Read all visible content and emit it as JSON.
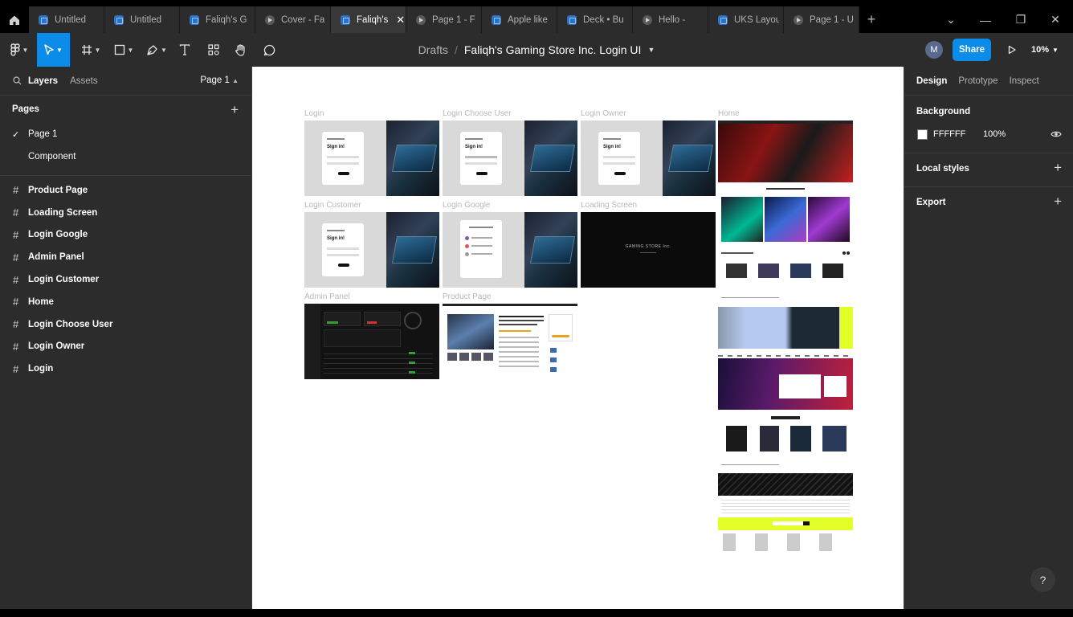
{
  "tabs": [
    {
      "label": "Untitled",
      "type": "file",
      "active": false
    },
    {
      "label": "Untitled",
      "type": "file",
      "active": false
    },
    {
      "label": "Faliqh's G",
      "type": "file",
      "active": false
    },
    {
      "label": "Cover - Fa",
      "type": "proto",
      "active": false
    },
    {
      "label": "Faliqh's",
      "type": "file",
      "active": true
    },
    {
      "label": "Page 1 - F",
      "type": "proto",
      "active": false
    },
    {
      "label": "Apple like",
      "type": "file",
      "active": false
    },
    {
      "label": "Deck • Bu",
      "type": "file",
      "active": false
    },
    {
      "label": "Hello -",
      "type": "proto",
      "active": false
    },
    {
      "label": "UKS Layou",
      "type": "file",
      "active": false
    },
    {
      "label": "Page 1 - U",
      "type": "proto",
      "active": false
    }
  ],
  "toolbar": {
    "breadcrumb_drafts": "Drafts",
    "breadcrumb_sep": "/",
    "file_name": "Faliqh's Gaming Store Inc. Login UI",
    "avatar_initial": "M",
    "share_label": "Share",
    "zoom_label": "10%"
  },
  "left_panel": {
    "tab_layers": "Layers",
    "tab_assets": "Assets",
    "page_selector": "Page 1",
    "pages_title": "Pages",
    "pages": [
      "Page 1",
      "Component"
    ],
    "layers": [
      "Product Page",
      "Loading Screen",
      "Login Google",
      "Admin Panel",
      "Login Customer",
      "Home",
      "Login Choose User",
      "Login Owner",
      "Login"
    ]
  },
  "canvas": {
    "frames": {
      "login": "Login",
      "login_choose_user": "Login Choose User",
      "login_owner": "Login Owner",
      "home": "Home",
      "login_customer": "Login Customer",
      "login_google": "Login Google",
      "loading_screen": "Loading Screen",
      "admin_panel": "Admin Panel",
      "product_page": "Product Page"
    },
    "mini_text": {
      "sign_in": "Sign in!",
      "gaming_store": "GAMING STORE Inc."
    }
  },
  "right_panel": {
    "tab_design": "Design",
    "tab_prototype": "Prototype",
    "tab_inspect": "Inspect",
    "background_title": "Background",
    "background_hex": "FFFFFF",
    "background_opacity": "100%",
    "local_styles_title": "Local styles",
    "export_title": "Export"
  },
  "help_label": "?",
  "colors": {
    "accent": "#0c8ce9",
    "panel": "#2c2c2c",
    "canvas": "#ffffff"
  }
}
